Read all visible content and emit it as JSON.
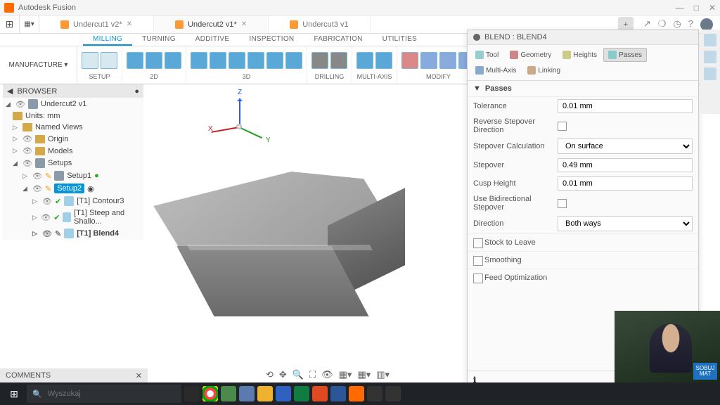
{
  "app": {
    "title": "Autodesk Fusion"
  },
  "doc_tabs": [
    {
      "label": "Undercut1 v2*"
    },
    {
      "label": "Undercut2 v1*"
    },
    {
      "label": "Undercut3 v1"
    }
  ],
  "ribbon": {
    "manufacture": "MANUFACTURE",
    "tabs": [
      "MILLING",
      "TURNING",
      "ADDITIVE",
      "INSPECTION",
      "FABRICATION",
      "UTILITIES"
    ],
    "groups": {
      "setup": "SETUP",
      "g2d": "2D",
      "g3d": "3D",
      "drilling": "DRILLING",
      "multiaxis": "MULTI-AXIS",
      "modify": "MODIFY"
    }
  },
  "browser": {
    "title": "BROWSER",
    "root": "Undercut2 v1",
    "units": "Units: mm",
    "named_views": "Named Views",
    "origin": "Origin",
    "models": "Models",
    "setups": "Setups",
    "setup1": "Setup1",
    "setup2": "Setup2",
    "op1": "[T1] Contour3",
    "op2": "[T1] Steep and Shallo...",
    "op3": "[T1] Blend4"
  },
  "panel": {
    "title": "BLEND : BLEND4",
    "tabs": {
      "tool": "Tool",
      "geometry": "Geometry",
      "heights": "Heights",
      "passes": "Passes",
      "multiaxis": "Multi-Axis",
      "linking": "Linking"
    },
    "section_passes": "Passes",
    "tolerance": {
      "label": "Tolerance",
      "value": "0.01 mm"
    },
    "reverse": {
      "label": "Reverse Stepover Direction"
    },
    "stepcalc": {
      "label": "Stepover Calculation",
      "value": "On surface"
    },
    "stepover": {
      "label": "Stepover",
      "value": "0.49 mm"
    },
    "cusp": {
      "label": "Cusp Height",
      "value": "0.01 mm"
    },
    "bidi": {
      "label": "Use Bidirectional Stepover"
    },
    "direction": {
      "label": "Direction",
      "value": "Both ways"
    },
    "stock": "Stock to Leave",
    "smoothing": "Smoothing",
    "feedopt": "Feed Optimization"
  },
  "axes": {
    "x": "X",
    "y": "Y",
    "z": "Z"
  },
  "comments": "COMMENTS",
  "taskbar": {
    "search_placeholder": "Wyszukaj"
  },
  "webcam_badge": "SOBUJ MAT"
}
